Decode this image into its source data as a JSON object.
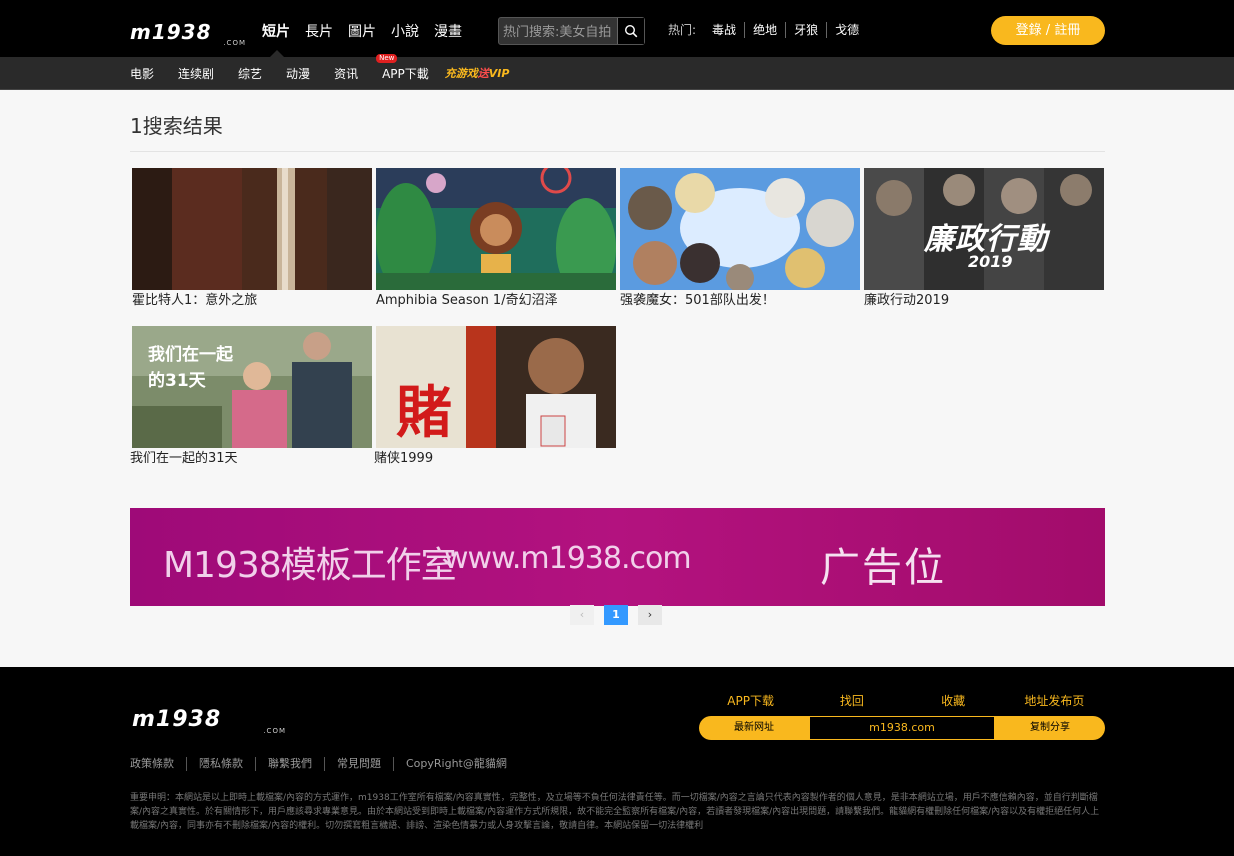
{
  "header": {
    "logo_text": "m1938",
    "logo_sub": ".COM",
    "nav": [
      {
        "label": "短片",
        "active": true
      },
      {
        "label": "長片"
      },
      {
        "label": "圖片"
      },
      {
        "label": "小說"
      },
      {
        "label": "漫畫"
      }
    ],
    "search": {
      "placeholder": "热门搜索:美女自拍"
    },
    "hot_label": "热门:",
    "hot_keywords": [
      "毒战",
      "绝地",
      "牙狼",
      "戈德"
    ],
    "login_label": "登錄 / 註冊"
  },
  "subnav": {
    "items": [
      "电影",
      "连续剧",
      "综艺",
      "动漫",
      "资讯",
      "APP下載"
    ],
    "new_badge": "New",
    "vip_label_a": "充游戏",
    "vip_label_b": "送",
    "vip_label_c": "VIP"
  },
  "main": {
    "heading": "1搜索结果",
    "results": [
      {
        "title": "霍比特人1：意外之旅"
      },
      {
        "title": "Amphibia Season 1/奇幻沼泽"
      },
      {
        "title": "强袭魔女：501部队出发！"
      },
      {
        "title": "廉政行动2019"
      },
      {
        "title": "我们在一起的31天"
      },
      {
        "title": "赌侠1999"
      }
    ],
    "thumb_texts": {
      "icac": "廉政行動",
      "icac_year": "2019",
      "days": "我们在一起",
      "days2": "的31天",
      "gamble": "賭"
    }
  },
  "ad": {
    "studio": "M1938模板工作室",
    "url": "www.m1938.com",
    "slot": "广告位"
  },
  "pagination": {
    "prev": "‹",
    "current": "1",
    "next": "›"
  },
  "footer": {
    "logo_text": "m1938",
    "logo_sub": ".COM",
    "links": [
      "政策條款",
      "隱私條款",
      "聯繫我們",
      "常見問題",
      "CopyRight@龍貓網"
    ],
    "tabs": [
      "APP下载",
      "找回",
      "收藏",
      "地址发布页"
    ],
    "bar_left": "最新网址",
    "bar_mid": "m1938.com",
    "bar_right": "复制分享",
    "notice": "重要申明：本網站是以上即時上載檔案/內容的方式運作，m1938工作室所有檔案/內容真實性，完整性，及立場等不負任何法律責任等。而一切檔案/內容之言論只代表內容製作者的個人意見，是非本網站立場，用戶不應信賴內容，並自行判斷檔案/內容之真實性。於有關情形下，用戶應該尋求專業意見。由於本網站受到即時上載檔案/內容運作方式所規限，故不能完全監察所有檔案/內容，若讀者發現檔案/內容出現問題，請聯繫我們。龍貓網有權刪除任何檔案/內容以及有權拒絕任何人上載檔案/內容，同事亦有不刪除檔案/內容的權利。切勿撰寫粗言穢語、誹謗、渲染色情暴力或人身攻擊言論，敬請自律。本網站保留一切法律權利"
  }
}
